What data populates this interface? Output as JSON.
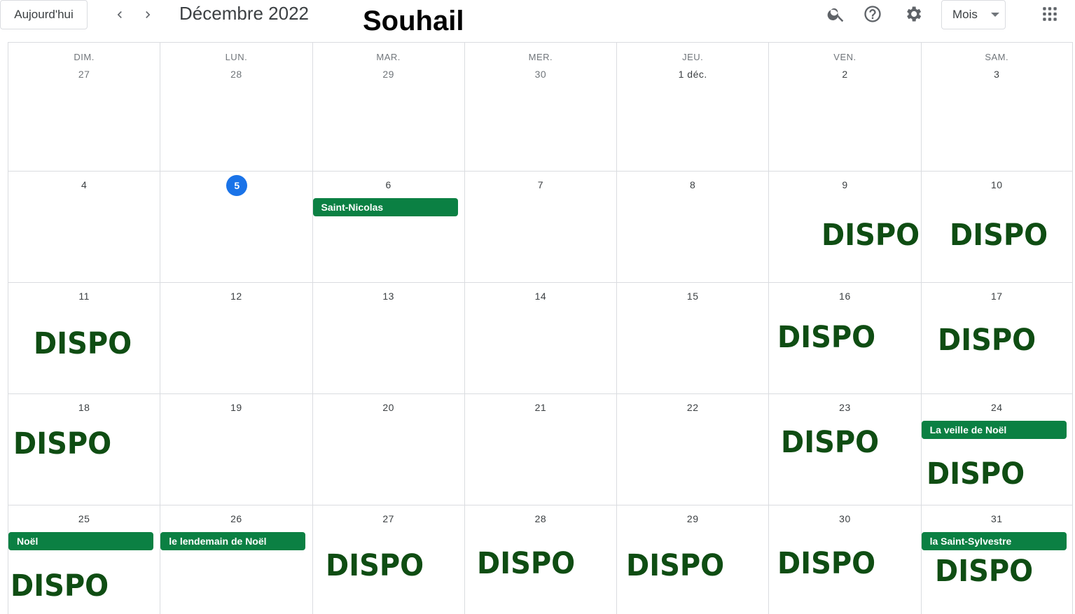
{
  "toolbar": {
    "today_label": "Aujourd'hui",
    "prev_icon": "chevron-left-icon",
    "next_icon": "chevron-right-icon",
    "month_title": "Décembre 2022",
    "overlay_name": "Souhail",
    "view_label": "Mois",
    "search_icon": "search-icon",
    "help_icon": "help-icon",
    "settings_icon": "gear-icon",
    "apps_icon": "apps-grid-icon"
  },
  "colors": {
    "today_accent": "#1a73e8",
    "event_green": "#0b8043",
    "dispo_text": "#0f4d13"
  },
  "weekdays": [
    "DIM.",
    "LUN.",
    "MAR.",
    "MER.",
    "JEU.",
    "VEN.",
    "SAM."
  ],
  "dispo_text": "DISPO",
  "weeks": [
    {
      "days": [
        {
          "label": "27",
          "muted": true
        },
        {
          "label": "28",
          "muted": true
        },
        {
          "label": "29",
          "muted": true
        },
        {
          "label": "30",
          "muted": true
        },
        {
          "label": "1 déc.",
          "muted": false
        },
        {
          "label": "2",
          "muted": false
        },
        {
          "label": "3",
          "muted": false
        }
      ]
    },
    {
      "days": [
        {
          "label": "4"
        },
        {
          "label": "5",
          "today": true
        },
        {
          "label": "6",
          "event": "Saint-Nicolas"
        },
        {
          "label": "7"
        },
        {
          "label": "8"
        },
        {
          "label": "9",
          "dispo": true
        },
        {
          "label": "10",
          "dispo": true
        }
      ]
    },
    {
      "days": [
        {
          "label": "11",
          "dispo": true
        },
        {
          "label": "12"
        },
        {
          "label": "13"
        },
        {
          "label": "14"
        },
        {
          "label": "15"
        },
        {
          "label": "16",
          "dispo": true
        },
        {
          "label": "17",
          "dispo": true
        }
      ]
    },
    {
      "days": [
        {
          "label": "18",
          "dispo": true
        },
        {
          "label": "19"
        },
        {
          "label": "20"
        },
        {
          "label": "21"
        },
        {
          "label": "22"
        },
        {
          "label": "23",
          "dispo": true
        },
        {
          "label": "24",
          "event": "La veille de Noël",
          "dispo": true
        }
      ]
    },
    {
      "days": [
        {
          "label": "25",
          "event": "Noël",
          "dispo": true
        },
        {
          "label": "26",
          "event": "le lendemain de Noël"
        },
        {
          "label": "27",
          "dispo": true
        },
        {
          "label": "28",
          "dispo": true
        },
        {
          "label": "29",
          "dispo": true
        },
        {
          "label": "30",
          "dispo": true
        },
        {
          "label": "31",
          "event": "la Saint-Sylvestre",
          "dispo": true
        }
      ]
    }
  ]
}
